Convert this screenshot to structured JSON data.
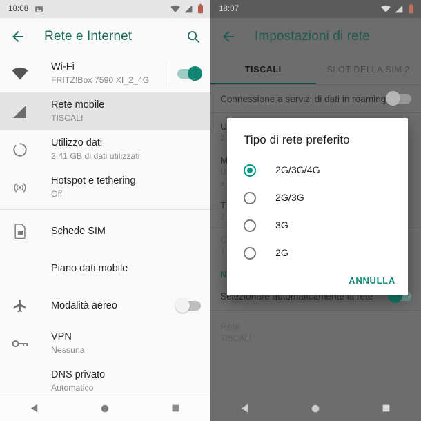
{
  "left_phone": {
    "status_bar": {
      "time": "18:08",
      "left_icons": [
        "image-icon"
      ],
      "right_icons": [
        "wifi-icon",
        "cellular-signal-icon",
        "battery-icon"
      ]
    },
    "app_bar": {
      "back_icon": "arrow-back-icon",
      "title": "Rete e Internet",
      "search_icon": "search-icon"
    },
    "items": [
      {
        "icon": "wifi-icon",
        "title": "Wi-Fi",
        "subtitle": "FRITZ!Box 7590 XI_2_4G",
        "toggle": "on",
        "selected": false,
        "divider_before": false
      },
      {
        "icon": "signal-icon",
        "title": "Rete mobile",
        "subtitle": "TISCALI",
        "toggle": null,
        "selected": true,
        "divider_before": false
      },
      {
        "icon": "data-usage-icon",
        "title": "Utilizzo dati",
        "subtitle": "2,41 GB di dati utilizzati",
        "toggle": null,
        "selected": false,
        "divider_before": false
      },
      {
        "icon": "hotspot-icon",
        "title": "Hotspot e tethering",
        "subtitle": "Off",
        "toggle": null,
        "selected": false,
        "divider_before": false
      },
      {
        "icon": "sim-card-icon",
        "title": "Schede SIM",
        "subtitle": "",
        "toggle": null,
        "selected": false,
        "divider_before": true
      },
      {
        "icon": "",
        "title": "Piano dati mobile",
        "subtitle": "",
        "toggle": null,
        "selected": false,
        "divider_before": false
      },
      {
        "icon": "airplane-icon",
        "title": "Modalità aereo",
        "subtitle": "",
        "toggle": "off",
        "selected": false,
        "divider_before": false
      },
      {
        "icon": "vpn-key-icon",
        "title": "VPN",
        "subtitle": "Nessuna",
        "toggle": null,
        "selected": false,
        "divider_before": false
      },
      {
        "icon": "",
        "title": "DNS privato",
        "subtitle": "Automatico",
        "toggle": null,
        "selected": false,
        "divider_before": false
      }
    ],
    "nav_bar": {
      "back": "back-triangle-icon",
      "home": "home-circle-icon",
      "recents": "recents-square-icon"
    }
  },
  "right_phone": {
    "status_bar": {
      "time": "18:07",
      "right_icons": [
        "wifi-icon",
        "cellular-signal-icon",
        "battery-icon"
      ]
    },
    "app_bar": {
      "back_icon": "arrow-back-icon",
      "title": "Impostazioni di rete"
    },
    "tabs": [
      {
        "label": "TISCALI",
        "active": true
      },
      {
        "label": "SLOT DELLA SIM 2",
        "active": false
      }
    ],
    "background_rows": [
      {
        "title": "Connessione a servizi di dati in roaming",
        "subtitle": "",
        "toggle": "off_dim",
        "type": "row"
      },
      {
        "title": "Utilizzo dei dati",
        "subtitle": "2",
        "toggle": null,
        "type": "row"
      },
      {
        "title": "M",
        "subtitle": "U\na",
        "toggle": "on_dim",
        "type": "clipped"
      },
      {
        "title": "T",
        "subtitle": "2",
        "toggle": null,
        "type": "clipped"
      },
      {
        "title": "C",
        "subtitle": "T",
        "toggle": null,
        "type": "clipped"
      }
    ],
    "section_header": "Network",
    "auto_select_row": {
      "title": "Selezionare automaticamente la rete",
      "toggle": "on_dim"
    },
    "network_row": {
      "title": "Rete",
      "subtitle": "TISCALI"
    },
    "nav_bar": {
      "back": "back-triangle-icon",
      "home": "home-circle-icon",
      "recents": "recents-square-icon"
    }
  },
  "dialog": {
    "title": "Tipo di rete preferito",
    "options": [
      {
        "label": "2G/3G/4G",
        "selected": true
      },
      {
        "label": "2G/3G",
        "selected": false
      },
      {
        "label": "3G",
        "selected": false
      },
      {
        "label": "2G",
        "selected": false
      }
    ],
    "cancel_label": "ANNULLA"
  },
  "colors": {
    "accent_teal": "#1c6b5d",
    "toggle_on": "#128573",
    "radio_selected": "#009985",
    "dialog_action": "#0e8a74",
    "scrim": "#6d6d6d",
    "selected_row_bg": "#e4e4e4"
  }
}
